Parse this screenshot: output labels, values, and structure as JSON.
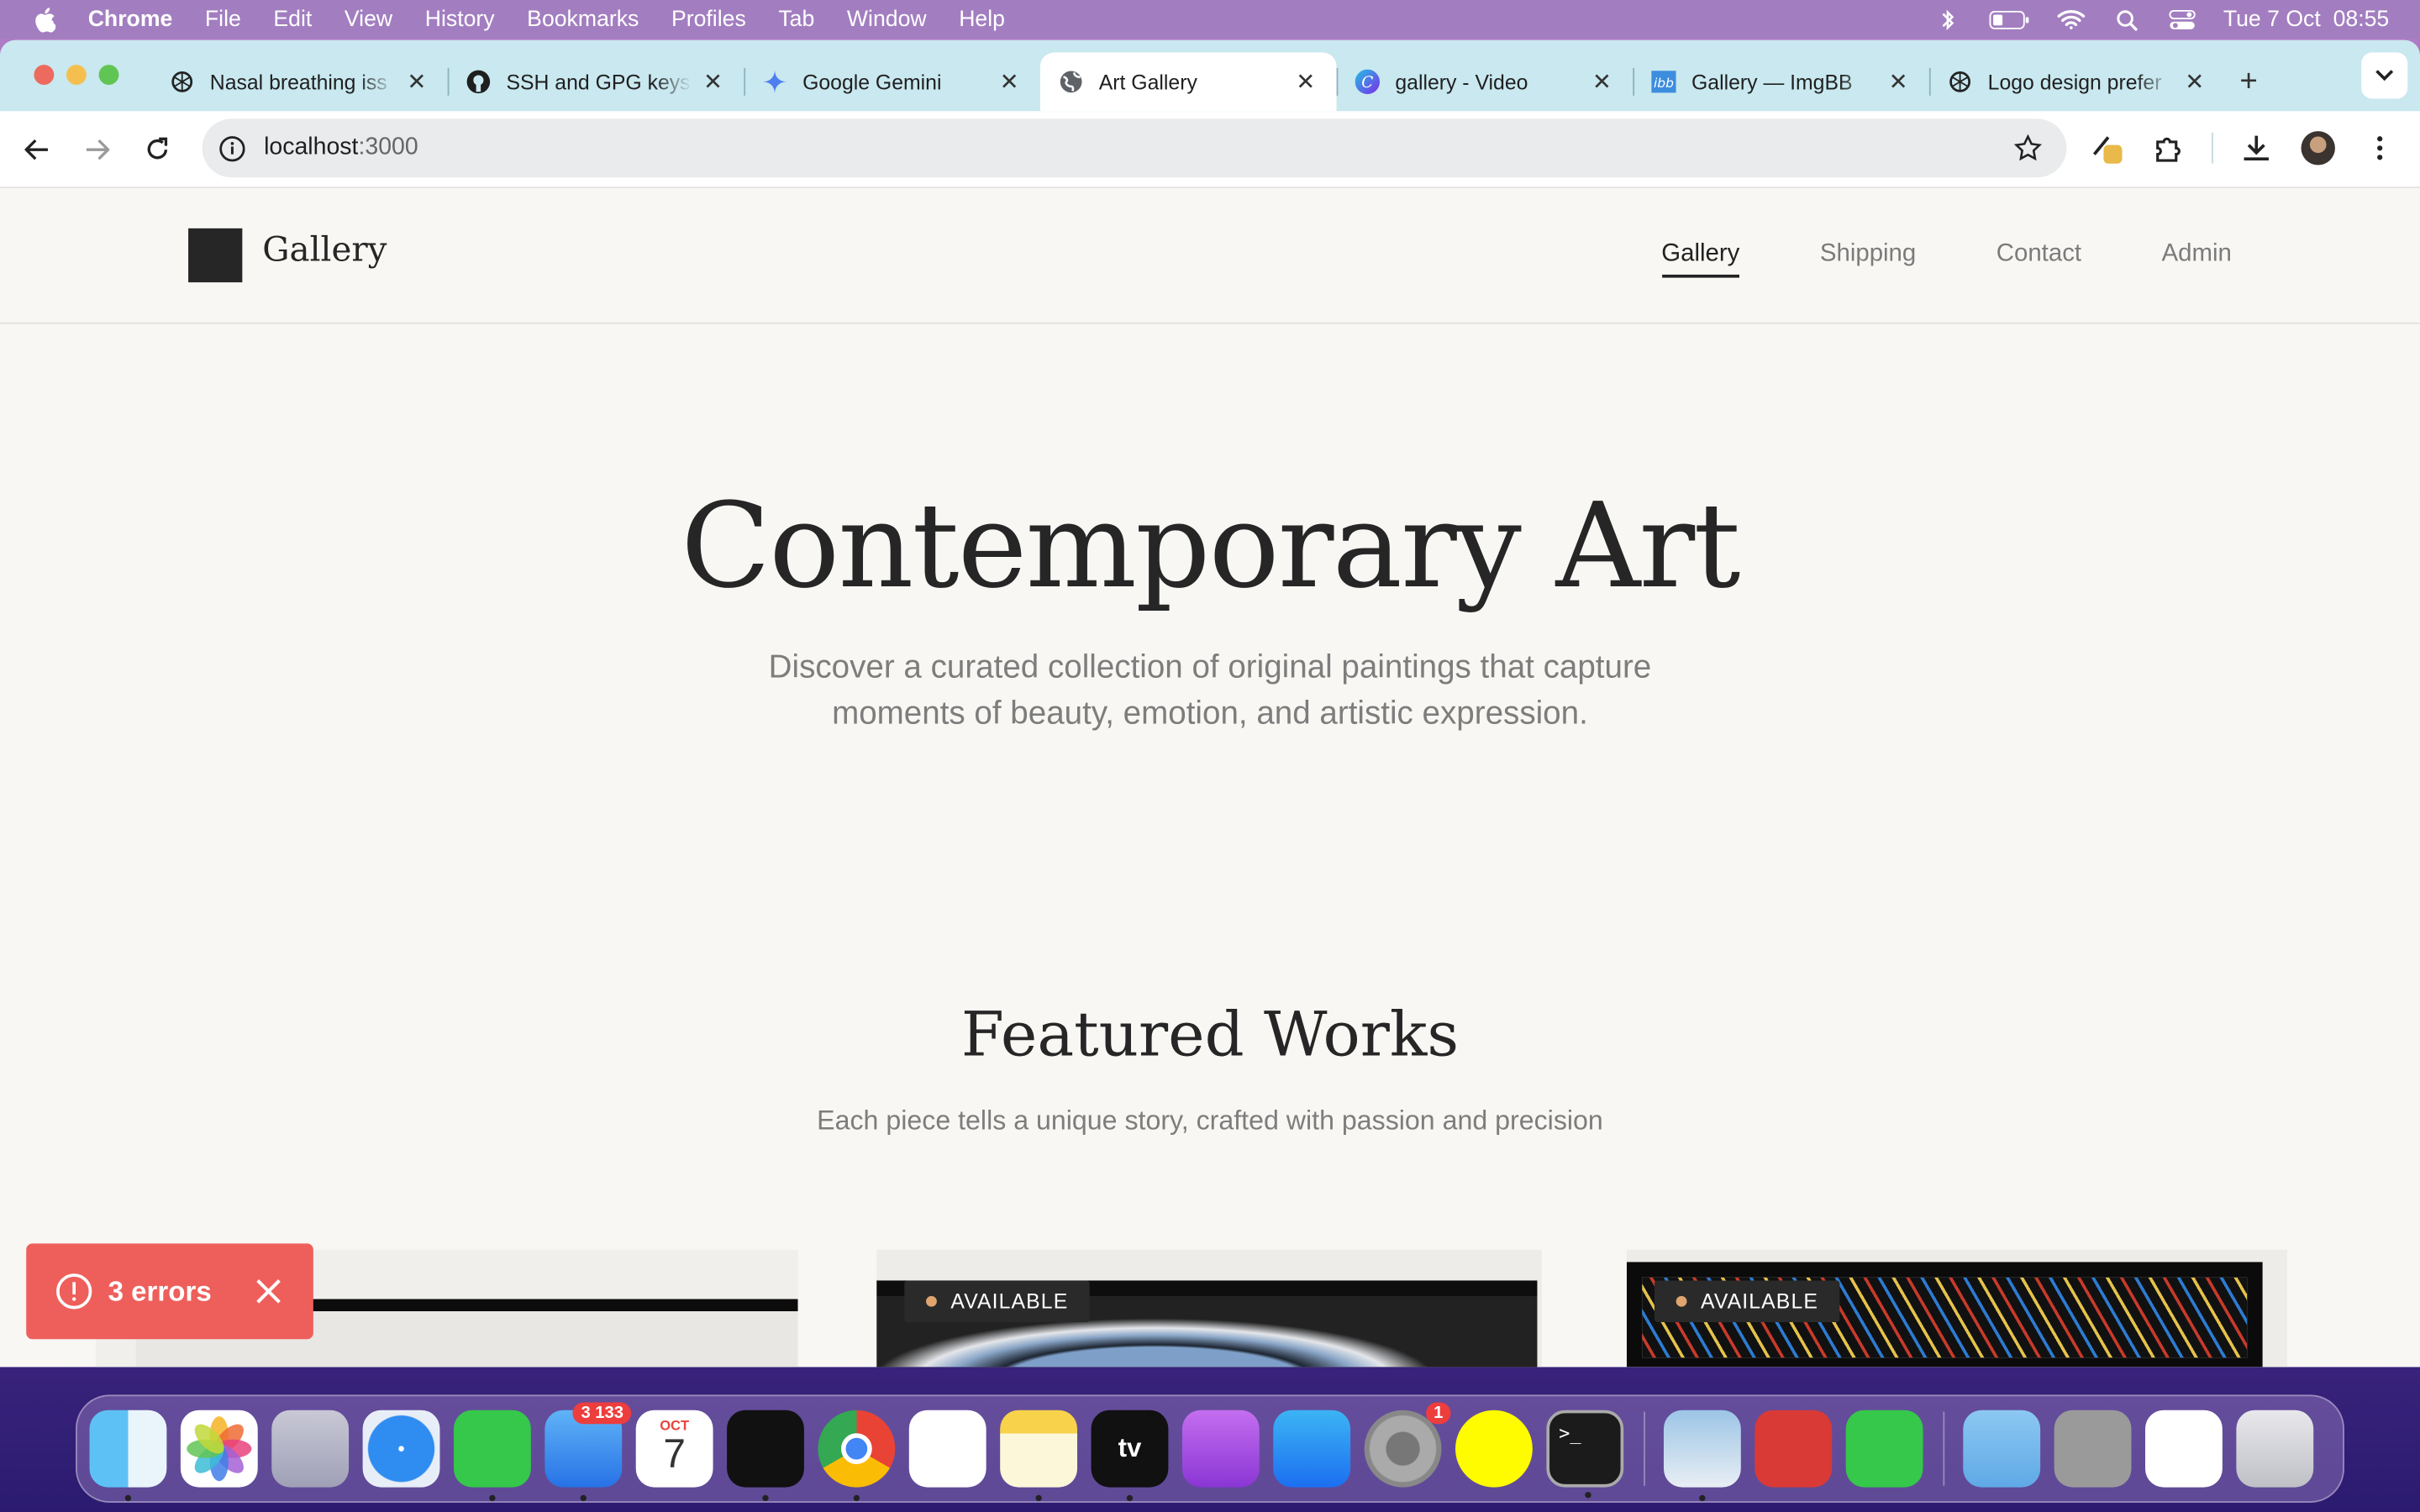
{
  "menubar": {
    "app": "Chrome",
    "items": [
      "File",
      "Edit",
      "View",
      "History",
      "Bookmarks",
      "Profiles",
      "Tab",
      "Window",
      "Help"
    ],
    "datetime": "Tue 7 Oct  08:55"
  },
  "tabs": [
    {
      "title": "Nasal breathing iss",
      "icon": "openai-icon"
    },
    {
      "title": "SSH and GPG keys",
      "icon": "github-icon"
    },
    {
      "title": "Google Gemini",
      "icon": "gemini-icon"
    },
    {
      "title": "Art Gallery",
      "icon": "globe-icon",
      "active": true
    },
    {
      "title": "gallery - Video",
      "icon": "canva-icon"
    },
    {
      "title": "Gallery — ImgBB",
      "icon": "imgbb-icon"
    },
    {
      "title": "Logo design prefer",
      "icon": "openai-icon"
    }
  ],
  "omnibox": {
    "host": "localhost",
    "port": ":3000"
  },
  "site": {
    "logo_text": "Gallery",
    "nav": [
      "Gallery",
      "Shipping",
      "Contact",
      "Admin"
    ],
    "hero_title": "Contemporary Art",
    "hero_text": "Discover a curated collection of original paintings that capture moments of beauty, emotion, and artistic expression.",
    "featured_title": "Featured Works",
    "featured_text": "Each piece tells a unique story, crafted with passion and precision",
    "badges": [
      "AVAILABLE",
      "AVAILABLE"
    ]
  },
  "error_toast": {
    "label": "3 errors"
  },
  "dock": {
    "mail_badge": "3 133",
    "calendar_month": "OCT",
    "calendar_day": "7",
    "settings_badge": "1"
  },
  "colors": {
    "accent": "#262626",
    "error": "#ee5f5b",
    "tabbar": "#c9e8ef"
  }
}
